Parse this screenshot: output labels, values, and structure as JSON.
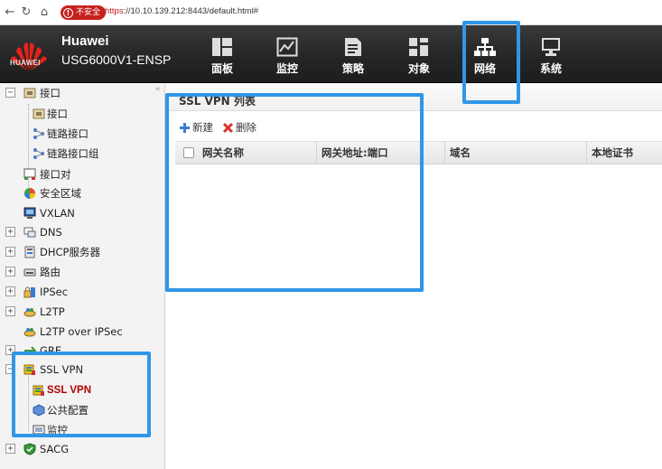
{
  "browser": {
    "security_label": "不安全",
    "url_scheme": "https",
    "url_rest": "://10.10.139.212:8443/default.html#"
  },
  "header": {
    "logo_text": "HUAWEI",
    "brand_name": "Huawei",
    "model": "USG6000V1-ENSP",
    "nav": [
      {
        "label": "面板",
        "icon": "dashboard-icon"
      },
      {
        "label": "监控",
        "icon": "monitor-icon"
      },
      {
        "label": "策略",
        "icon": "policy-icon"
      },
      {
        "label": "对象",
        "icon": "object-icon"
      },
      {
        "label": "网络",
        "icon": "network-icon",
        "active": true
      },
      {
        "label": "系统",
        "icon": "system-icon"
      }
    ]
  },
  "sidebar": {
    "items": [
      {
        "label": "接口"
      },
      {
        "label": "接口"
      },
      {
        "label": "链路接口"
      },
      {
        "label": "链路接口组"
      },
      {
        "label": "接口对"
      },
      {
        "label": "安全区域"
      },
      {
        "label": "VXLAN"
      },
      {
        "label": "DNS"
      },
      {
        "label": "DHCP服务器"
      },
      {
        "label": "路由"
      },
      {
        "label": "IPSec"
      },
      {
        "label": "L2TP"
      },
      {
        "label": "L2TP over IPSec"
      },
      {
        "label": "GRE"
      },
      {
        "label": "SSL VPN"
      },
      {
        "label": "SSL VPN"
      },
      {
        "label": "公共配置"
      },
      {
        "label": "监控"
      },
      {
        "label": "SACG"
      }
    ]
  },
  "main": {
    "title": "SSL VPN 列表",
    "toolbar": {
      "new_label": "新建",
      "delete_label": "删除"
    },
    "columns": [
      "网关名称",
      "网关地址:端口",
      "域名",
      "本地证书"
    ]
  },
  "colors": {
    "highlight": "#2f96e8",
    "selected_text": "#b00000",
    "brand_red": "#e2231a"
  }
}
